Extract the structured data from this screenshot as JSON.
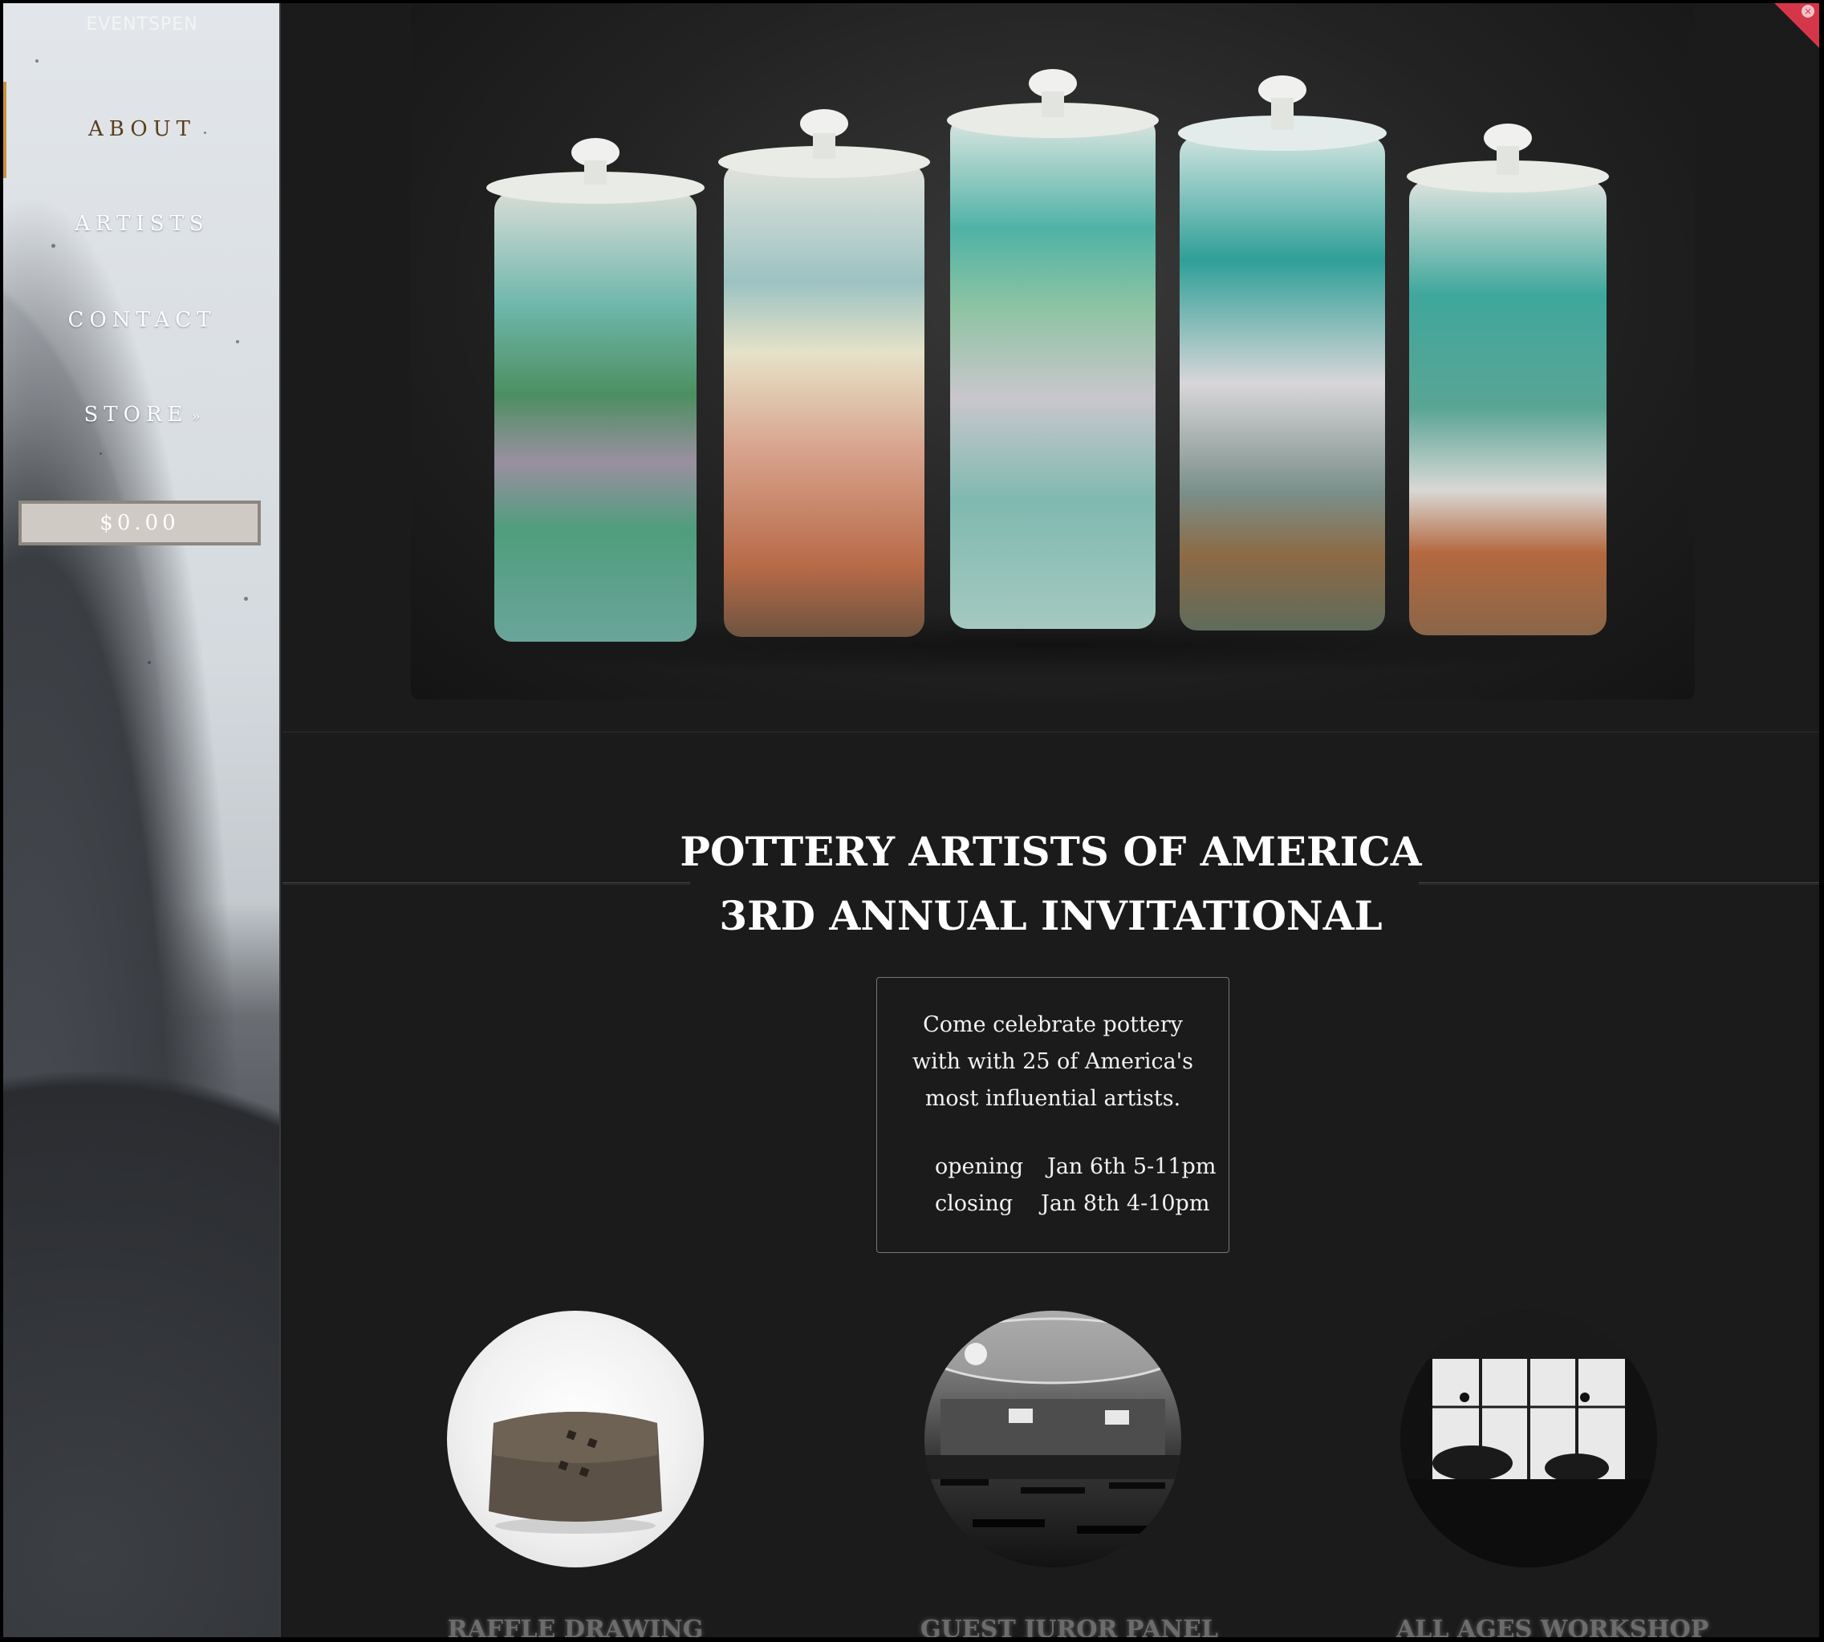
{
  "sidebar": {
    "brand": "EVENTSPEN",
    "nav": [
      {
        "label": "ABOUT"
      },
      {
        "label": "ARTISTS"
      },
      {
        "label": "CONTACT"
      },
      {
        "label": "STORE"
      }
    ],
    "cart_total": "$0.00"
  },
  "hero": {
    "image": "ceramic-jars-photo"
  },
  "event": {
    "title_line1": "POTTERY ARTISTS OF AMERICA",
    "title_line2": "3RD ANNUAL INVITATIONAL",
    "desc_line1": "Come celebrate pottery",
    "desc_line2": "with with 25 of America's",
    "desc_line3": "most influential artists.",
    "opening_label": "opening",
    "opening_value": "Jan 6th 5-11pm",
    "closing_label": "closing",
    "closing_value": "Jan 8th 4-10pm"
  },
  "features": [
    {
      "label": "RAFFLE DRAWING"
    },
    {
      "label": "GUEST JUROR PANEL"
    },
    {
      "label": "ALL AGES WORKSHOP"
    }
  ],
  "colors": {
    "accent": "#c8933e",
    "background": "#1b1b1c",
    "badge": "#d6364a"
  }
}
